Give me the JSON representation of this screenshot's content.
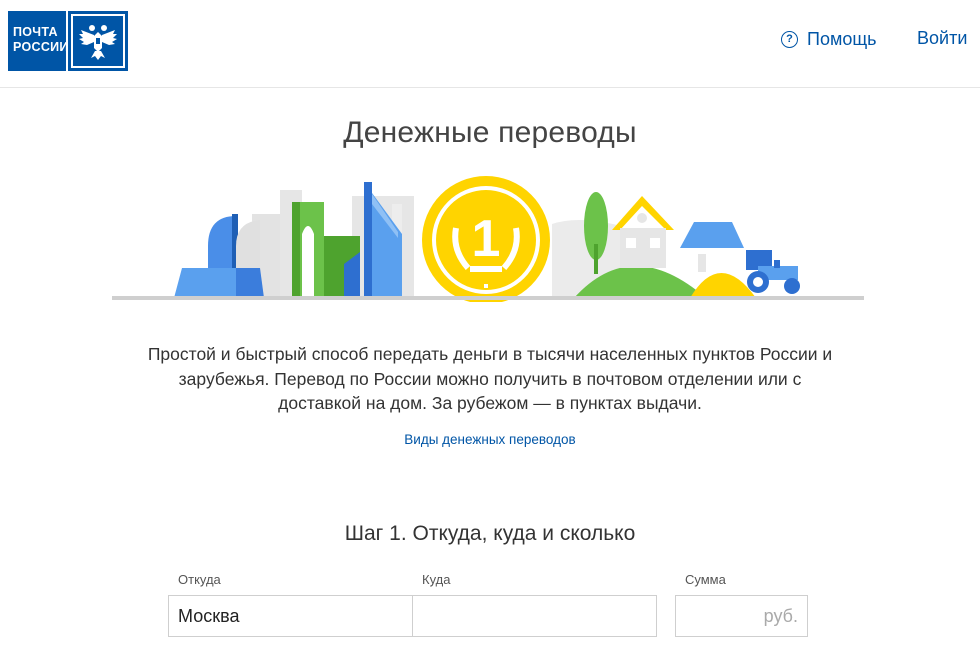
{
  "header": {
    "logo_text_line1": "ПОЧТА",
    "logo_text_line2": "РОССИИ",
    "help_icon_glyph": "?",
    "help_label": "Помощь",
    "login_label": "Войти",
    "brand_color": "#0055a6"
  },
  "page": {
    "title": "Денежные переводы",
    "description": "Простой и быстрый способ передать деньги в тысячи населенных пунктов России и зарубежья. Перевод по России можно получить в почтовом отделении или с доставкой на дом. За рубежом — в пунктах выдачи.",
    "types_link": "Виды денежных переводов",
    "illustration_coin_label": "1"
  },
  "form": {
    "step_title": "Шаг 1. Откуда, куда и сколько",
    "from_label": "Откуда",
    "from_value": "Москва",
    "to_label": "Куда",
    "to_value": "",
    "sum_label": "Сумма",
    "sum_placeholder": "руб."
  }
}
